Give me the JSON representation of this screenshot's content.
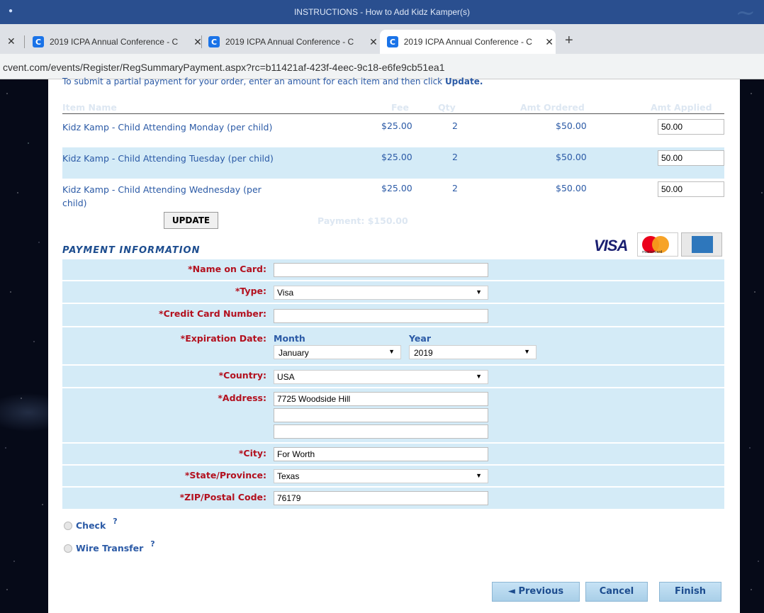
{
  "window": {
    "title": "INSTRUCTIONS - How to Add Kidz Kamper(s)"
  },
  "tabs": [
    {
      "label": "2019 ICPA Annual Conference - C",
      "favicon": "C"
    },
    {
      "label": "2019 ICPA Annual Conference - C",
      "favicon": "C"
    },
    {
      "label": "2019 ICPA Annual Conference - C",
      "favicon": "C"
    }
  ],
  "address": {
    "url": "cvent.com/events/Register/RegSummaryPayment.aspx?rc=b11421af-423f-4eec-9c18-e6fe9cb51ea1"
  },
  "instructions": {
    "text": "To submit a partial payment for your order, enter an amount for each item and then click ",
    "bold": "Update."
  },
  "table": {
    "headers": {
      "item": "Item Name",
      "fee": "Fee",
      "qty": "Qty",
      "ordered": "Amt Ordered",
      "applied": "Amt Applied"
    },
    "rows": [
      {
        "name": "Kidz Kamp - Child Attending Monday (per child)",
        "fee": "$25.00",
        "qty": "2",
        "ordered": "$50.00",
        "applied": "50.00"
      },
      {
        "name": "Kidz Kamp - Child Attending Tuesday (per child)",
        "fee": "$25.00",
        "qty": "2",
        "ordered": "$50.00",
        "applied": "50.00"
      },
      {
        "name": "Kidz Kamp - Child Attending Wednesday (per child)",
        "fee": "$25.00",
        "qty": "2",
        "ordered": "$50.00",
        "applied": "50.00"
      }
    ]
  },
  "update_label": "UPDATE",
  "payment_total": "Payment:  $150.00",
  "cards": {
    "visa": "VISA",
    "mastercard": "mastercard"
  },
  "payment_section": "PAYMENT INFORMATION",
  "form": {
    "name_label": "*Name on Card:",
    "name_value": "",
    "type_label": "*Type:",
    "type_value": "Visa",
    "card_label": "*Credit Card Number:",
    "card_value": "",
    "exp_label": "*Expiration Date:",
    "month_label": "Month",
    "month_value": "January",
    "year_label": "Year",
    "year_value": "2019",
    "country_label": "*Country:",
    "country_value": "USA",
    "address_label": "*Address:",
    "address1": "7725 Woodside Hill",
    "address2": "",
    "address3": "",
    "city_label": "*City:",
    "city_value": "For Worth",
    "state_label": "*State/Province:",
    "state_value": "Texas",
    "zip_label": "*ZIP/Postal Code:",
    "zip_value": "76179"
  },
  "methods": {
    "check": "Check",
    "wire": "Wire Transfer",
    "help": "?"
  },
  "buttons": {
    "previous": "◄ Previous",
    "cancel": "Cancel",
    "finish": "Finish"
  },
  "glyphs": {
    "close": "✕",
    "plus": "+",
    "arrow": "▼"
  },
  "colors": {
    "link_blue": "#2b5aa6",
    "required_red": "#b3111f",
    "form_bg": "#d4ebf7"
  }
}
